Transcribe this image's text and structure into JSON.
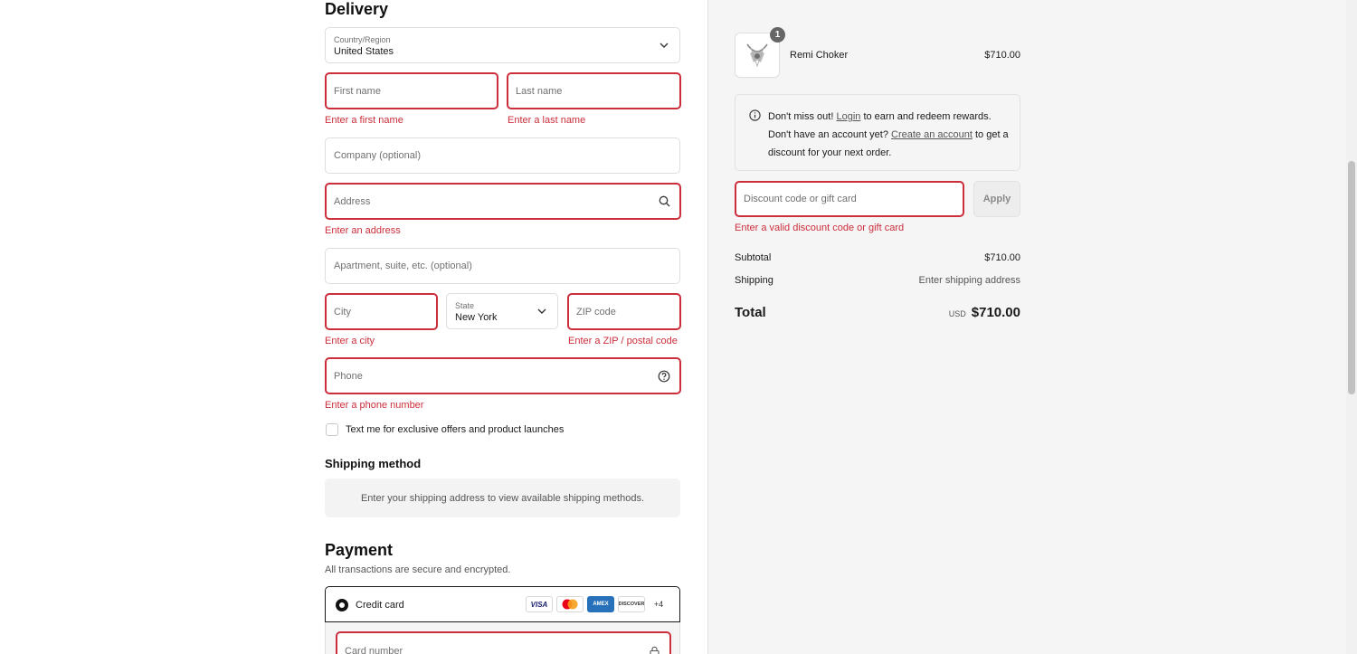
{
  "delivery": {
    "heading": "Delivery",
    "country": {
      "label": "Country/Region",
      "value": "United States"
    },
    "first_name": {
      "placeholder": "First name",
      "error": "Enter a first name"
    },
    "last_name": {
      "placeholder": "Last name",
      "error": "Enter a last name"
    },
    "company": {
      "placeholder": "Company (optional)"
    },
    "address": {
      "placeholder": "Address",
      "error": "Enter an address"
    },
    "apartment": {
      "placeholder": "Apartment, suite, etc. (optional)"
    },
    "city": {
      "placeholder": "City",
      "error": "Enter a city"
    },
    "state": {
      "label": "State",
      "value": "New York"
    },
    "zip": {
      "placeholder": "ZIP code",
      "error": "Enter a ZIP / postal code"
    },
    "phone": {
      "placeholder": "Phone",
      "error": "Enter a phone number"
    },
    "sms_optin_label": "Text me for exclusive offers and product launches"
  },
  "shipping": {
    "heading": "Shipping method",
    "message": "Enter your shipping address to view available shipping methods."
  },
  "payment": {
    "heading": "Payment",
    "subtext": "All transactions are secure and encrypted.",
    "method_label": "Credit card",
    "cards": [
      "VISA",
      "Mastercard",
      "AMEX",
      "DISCOVER"
    ],
    "more_cards": "+4",
    "card_number_placeholder": "Card number"
  },
  "summary": {
    "product": {
      "name": "Remi Choker",
      "price": "$710.00",
      "quantity": "1"
    },
    "rewards": {
      "prefix": "Don't miss out! ",
      "login_link": "Login",
      "middle": " to earn and redeem rewards. Don't have an account yet? ",
      "create_link": "Create an account",
      "suffix": " to get a discount for your next order."
    },
    "discount": {
      "placeholder": "Discount code or gift card",
      "error": "Enter a valid discount code or gift card",
      "apply_label": "Apply"
    },
    "subtotal_label": "Subtotal",
    "subtotal_value": "$710.00",
    "shipping_label": "Shipping",
    "shipping_value": "Enter shipping address",
    "total_label": "Total",
    "currency": "USD",
    "total_value": "$710.00"
  },
  "colors": {
    "error": "#cc2e3b",
    "summary_bg": "#f5f5f5",
    "amex": "#2671b9"
  }
}
